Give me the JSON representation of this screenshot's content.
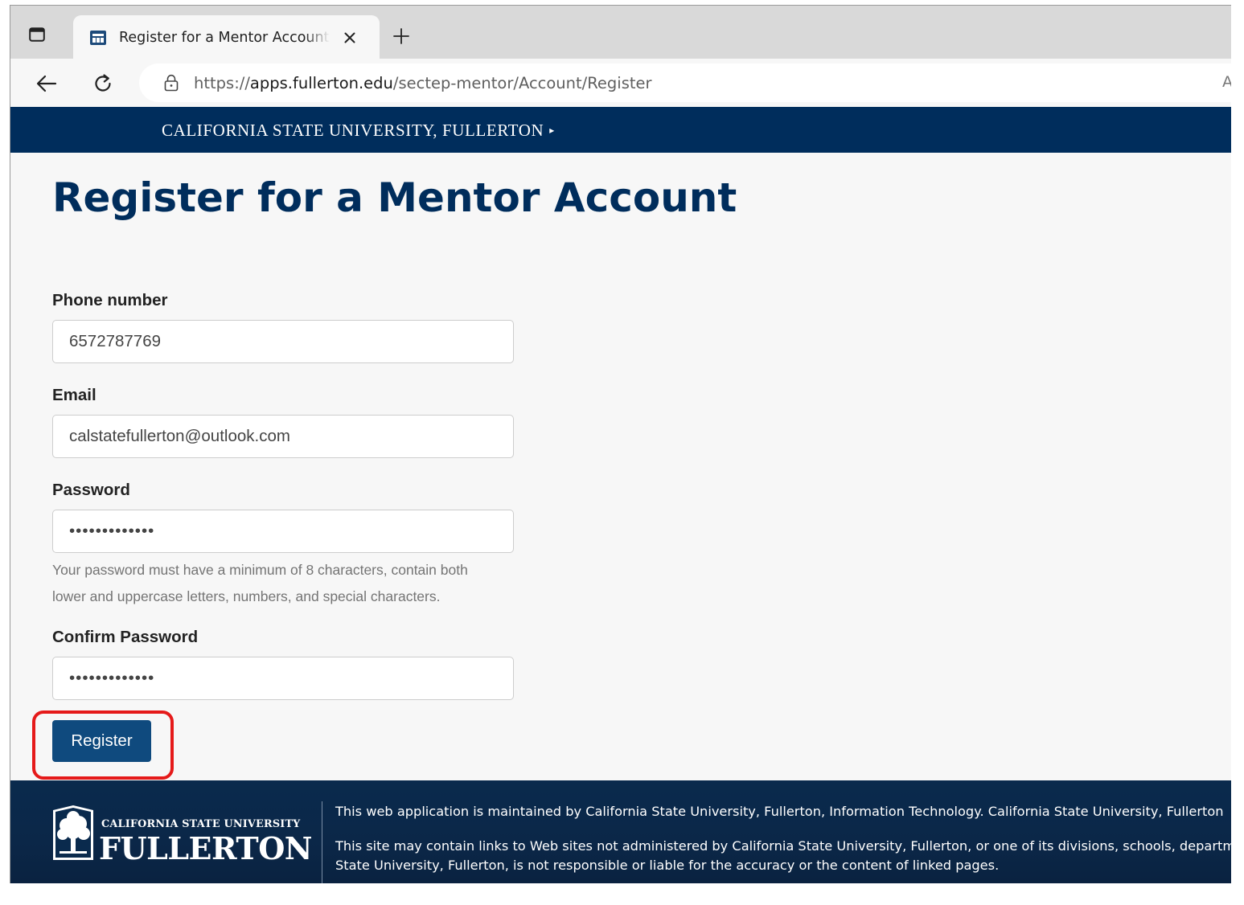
{
  "browser": {
    "tab_title": "Register for a Mentor Account - SECTEP Mentor",
    "url_scheme": "https://",
    "url_host": "apps.fullerton.edu",
    "url_path": "/sectep-mentor/Account/Register",
    "address_right_char": "A"
  },
  "site_header": {
    "university_link": "CALIFORNIA STATE UNIVERSITY, FULLERTON",
    "arrow": "▸"
  },
  "page": {
    "title": "Register for a Mentor Account"
  },
  "form": {
    "phone": {
      "label": "Phone number",
      "value": "6572787769"
    },
    "email": {
      "label": "Email",
      "value": "calstatefullerton@outlook.com"
    },
    "password": {
      "label": "Password",
      "value": "•••••••••••••",
      "help_line1": "Your password must have a minimum of 8 characters, contain both",
      "help_line2": "lower and uppercase letters, numbers, and special characters."
    },
    "confirm_password": {
      "label": "Confirm Password",
      "value": "•••••••••••••"
    },
    "submit_label": "Register"
  },
  "footer": {
    "logo_line1": "CALIFORNIA STATE UNIVERSITY",
    "logo_line2": "FULLERTON",
    "text1": "This web application is maintained by California State University, Fullerton, Information Technology. California State University, Fullerton",
    "text2_line1": "This site may contain links to Web sites not administered by California State University, Fullerton, or one of its divisions, schools, departments",
    "text2_line2": "State University, Fullerton, is not responsible or liable for the accuracy or the content of linked pages."
  },
  "colors": {
    "brand_navy": "#002d5c",
    "button_blue": "#0f4a7e",
    "highlight_red": "#e51a1a"
  }
}
